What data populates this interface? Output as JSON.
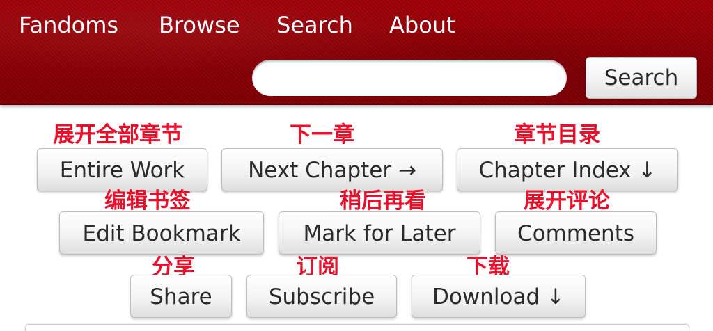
{
  "header": {
    "nav": [
      {
        "label": "Fandoms"
      },
      {
        "label": "Browse"
      },
      {
        "label": "Search"
      },
      {
        "label": "About"
      }
    ],
    "search": {
      "placeholder": "",
      "value": "",
      "button_label": "Search"
    },
    "colors": {
      "header_bg": "#8d0006",
      "header_text": "#ffffff"
    }
  },
  "actions": {
    "entire_work": {
      "label": "Entire Work",
      "annotation": "展开全部章节"
    },
    "next_chapter": {
      "label": "Next Chapter →",
      "annotation": "下一章"
    },
    "chapter_index": {
      "label": "Chapter Index ↓",
      "annotation": "章节目录"
    },
    "edit_bookmark": {
      "label": "Edit Bookmark",
      "annotation": "编辑书签"
    },
    "mark_for_later": {
      "label": "Mark for Later",
      "annotation": "稍后再看"
    },
    "comments": {
      "label": "Comments",
      "annotation": "展开评论"
    },
    "share": {
      "label": "Share",
      "annotation": "分享"
    },
    "subscribe": {
      "label": "Subscribe",
      "annotation": "订阅"
    },
    "download": {
      "label": "Download ↓",
      "annotation": "下载"
    }
  },
  "colors": {
    "annotation": "#e8102a",
    "button_text": "#2b2b2b"
  }
}
